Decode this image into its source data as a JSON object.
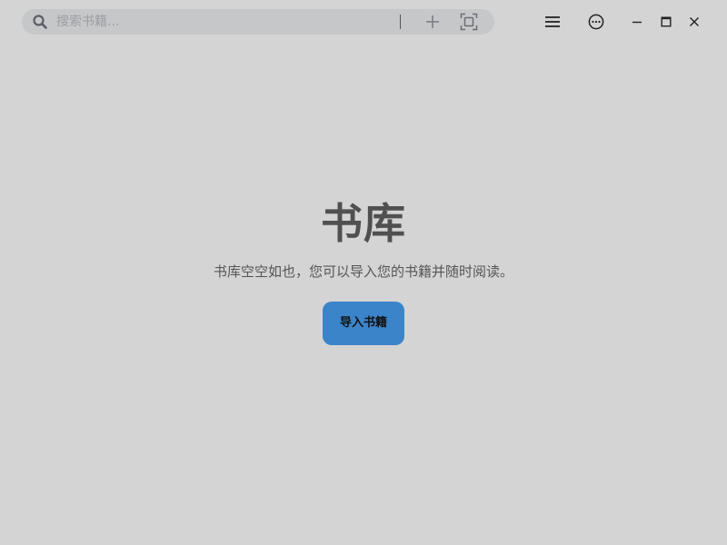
{
  "header": {
    "search": {
      "placeholder": "搜索书籍...",
      "value": ""
    },
    "icons": {
      "search": "search-icon",
      "add": "plus-icon",
      "scan": "scan-icon",
      "menu": "hamburger-menu-icon",
      "more": "more-options-icon",
      "minimize": "minimize-icon",
      "maximize": "maximize-icon",
      "close": "close-icon"
    }
  },
  "main": {
    "title": "书库",
    "description": "书库空空如也，您可以导入您的书籍并随时阅读。",
    "import_button_label": "导入书籍"
  },
  "colors": {
    "background": "#d4d4d4",
    "search_background": "#c6c7c8",
    "accent": "#3b84c9",
    "title_text": "#505050"
  }
}
